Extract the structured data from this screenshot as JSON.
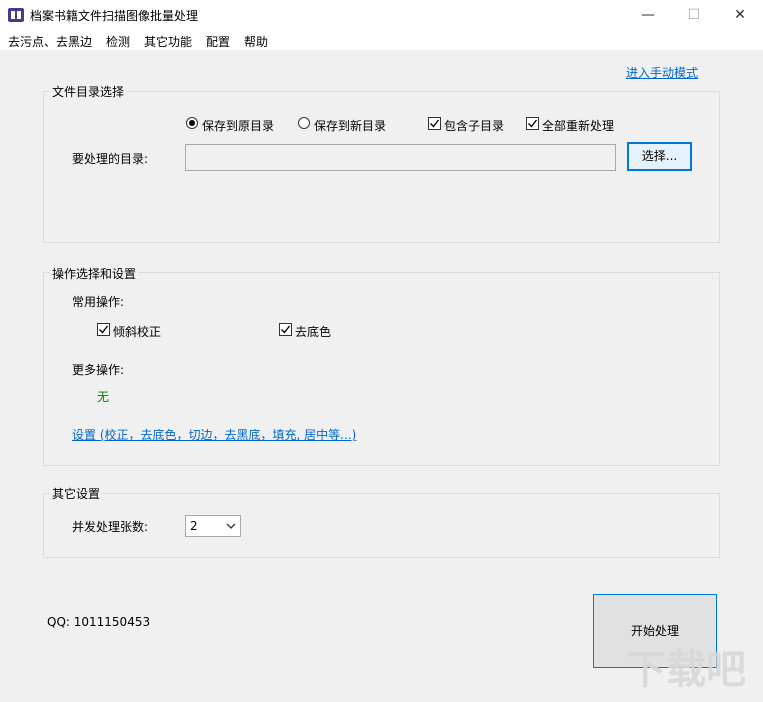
{
  "window": {
    "title": "档案书籍文件扫描图像批量处理",
    "minimize": "—",
    "maximize": "☐",
    "close": "✕"
  },
  "menu": [
    "去污点、去黑边",
    "检测",
    "其它功能",
    "配置",
    "帮助"
  ],
  "manual_mode_link": "进入手动模式",
  "file_group": {
    "title": "文件目录选择",
    "radio_save_original": "保存到原目录",
    "radio_save_new": "保存到新目录",
    "radio_selected": "保存到原目录",
    "checkbox_subdirs": "包含子目录",
    "checkbox_subdirs_checked": true,
    "checkbox_reprocess": "全部重新处理",
    "checkbox_reprocess_checked": true,
    "dir_label": "要处理的目录:",
    "dir_value": "",
    "choose_button": "选择..."
  },
  "ops_group": {
    "title": "操作选择和设置",
    "common_label": "常用操作:",
    "deskew": "倾斜校正",
    "deskew_checked": true,
    "remove_bg": "去底色",
    "remove_bg_checked": true,
    "more_label": "更多操作:",
    "more_value": "无",
    "settings_link": "设置 (校正，去底色，切边，去黑底，填充, 居中等...)"
  },
  "other_group": {
    "title": "其它设置",
    "concurrency_label": "并发处理张数:",
    "concurrency_value": "2"
  },
  "qq": "QQ: 1011150453",
  "start_button": "开始处理",
  "watermark": "下载吧"
}
